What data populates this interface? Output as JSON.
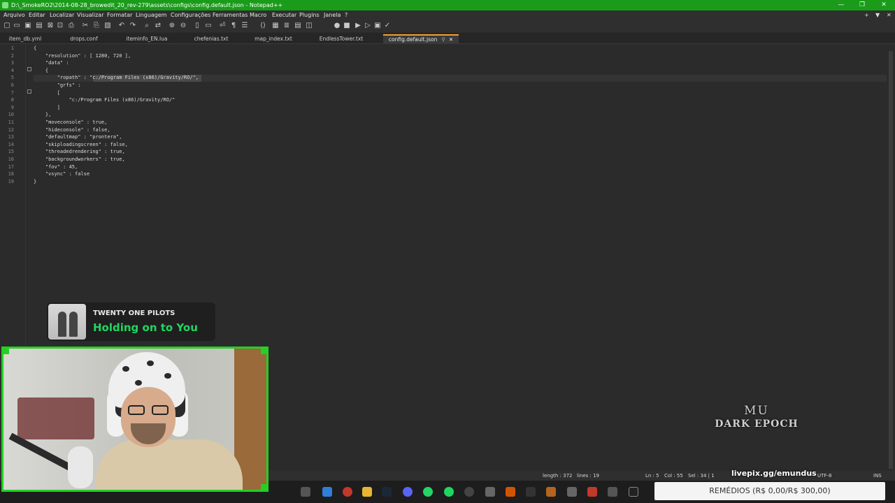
{
  "window": {
    "title": "D:\\_SmokeRO2\\2014-08-28_browedit_20_rev-279\\assets\\configs\\config.default.json - Notepad++",
    "minimize": "—",
    "maximize": "❐",
    "close": "✕"
  },
  "menu": {
    "items": [
      "Arquivo",
      "Editar",
      "Localizar",
      "Visualizar",
      "Formatar",
      "Linguagem",
      "Configurações",
      "Ferramentas",
      "Macro",
      "Executar",
      "Plugins",
      "Janela",
      "?"
    ],
    "right_add": "+",
    "right_down": "▼",
    "right_close": "✕"
  },
  "tabs": [
    {
      "label": "item_db.yml"
    },
    {
      "label": "drops.conf"
    },
    {
      "label": "iteminfo_EN.lua"
    },
    {
      "label": "chefenias.txt"
    },
    {
      "label": "map_index.txt"
    },
    {
      "label": "EndlessTower.txt"
    },
    {
      "label": "config.default.json",
      "active": true
    }
  ],
  "editor": {
    "line_numbers": [
      "1",
      "2",
      "3",
      "4",
      "5",
      "6",
      "7",
      "8",
      "9",
      "10",
      "11",
      "12",
      "13",
      "14",
      "15",
      "16",
      "17",
      "18",
      "19"
    ],
    "lines": [
      "{",
      "    \"resolution\" : [ 1280, 720 ],",
      "    \"data\" :",
      "    {",
      "        \"ropath\" : \"c:/Program Files (x86)/Gravity/RO/\",",
      "        \"grfs\" :",
      "        [",
      "            \"c:/Program Files (x86)/Gravity/RO/\"",
      "        ]",
      "    },",
      "    \"moveconsole\" : true,",
      "    \"hideconsole\" : false,",
      "    \"defaultmap\" : \"prontera\",",
      "    \"skiploadingscreen\" : false,",
      "    \"threadedrendering\" : true,",
      "    \"backgroundworkers\" : true,",
      "    \"fov\" : 45,",
      "    \"vsync\" : false",
      "}"
    ]
  },
  "status": {
    "length": "length : 372",
    "lines": "lines : 19",
    "ln": "Ln : 5",
    "col": "Col : 55",
    "sel": "Sel : 34 | 1",
    "encoding": "UTF-8",
    "mode": "INS"
  },
  "now_playing": {
    "artist": "TWENTY ONE PILOTS",
    "track": "Holding on to You"
  },
  "logo": {
    "line1": "MU",
    "line2": "DARK EPOCH"
  },
  "donation": {
    "link": "livepix.gg/emundus",
    "goal": "REMÉDIOS (R$ 0,00/R$ 300,00)"
  },
  "colors": {
    "title_bar": "#1a9c1a",
    "active_tab_accent": "#f0a030",
    "spotify_green": "#1ed760",
    "webcam_border": "#23d023"
  },
  "icons": {
    "toolbar": [
      "new-file-icon",
      "open-file-icon",
      "save-icon",
      "save-all-icon",
      "close-icon",
      "close-all-icon",
      "print-icon",
      "cut-icon",
      "copy-icon",
      "paste-icon",
      "undo-icon",
      "redo-icon",
      "find-icon",
      "replace-icon",
      "zoom-in-icon",
      "zoom-out-icon",
      "sync-v-icon",
      "sync-h-icon",
      "word-wrap-icon",
      "show-all-chars-icon",
      "indent-guide-icon",
      "lang-icon",
      "doc-map-icon",
      "func-list-icon",
      "folder-workspace-icon",
      "monitor-icon",
      "record-icon",
      "stop-icon",
      "play-icon",
      "play-multi-icon",
      "save-macro-icon",
      "spellcheck-icon"
    ]
  }
}
